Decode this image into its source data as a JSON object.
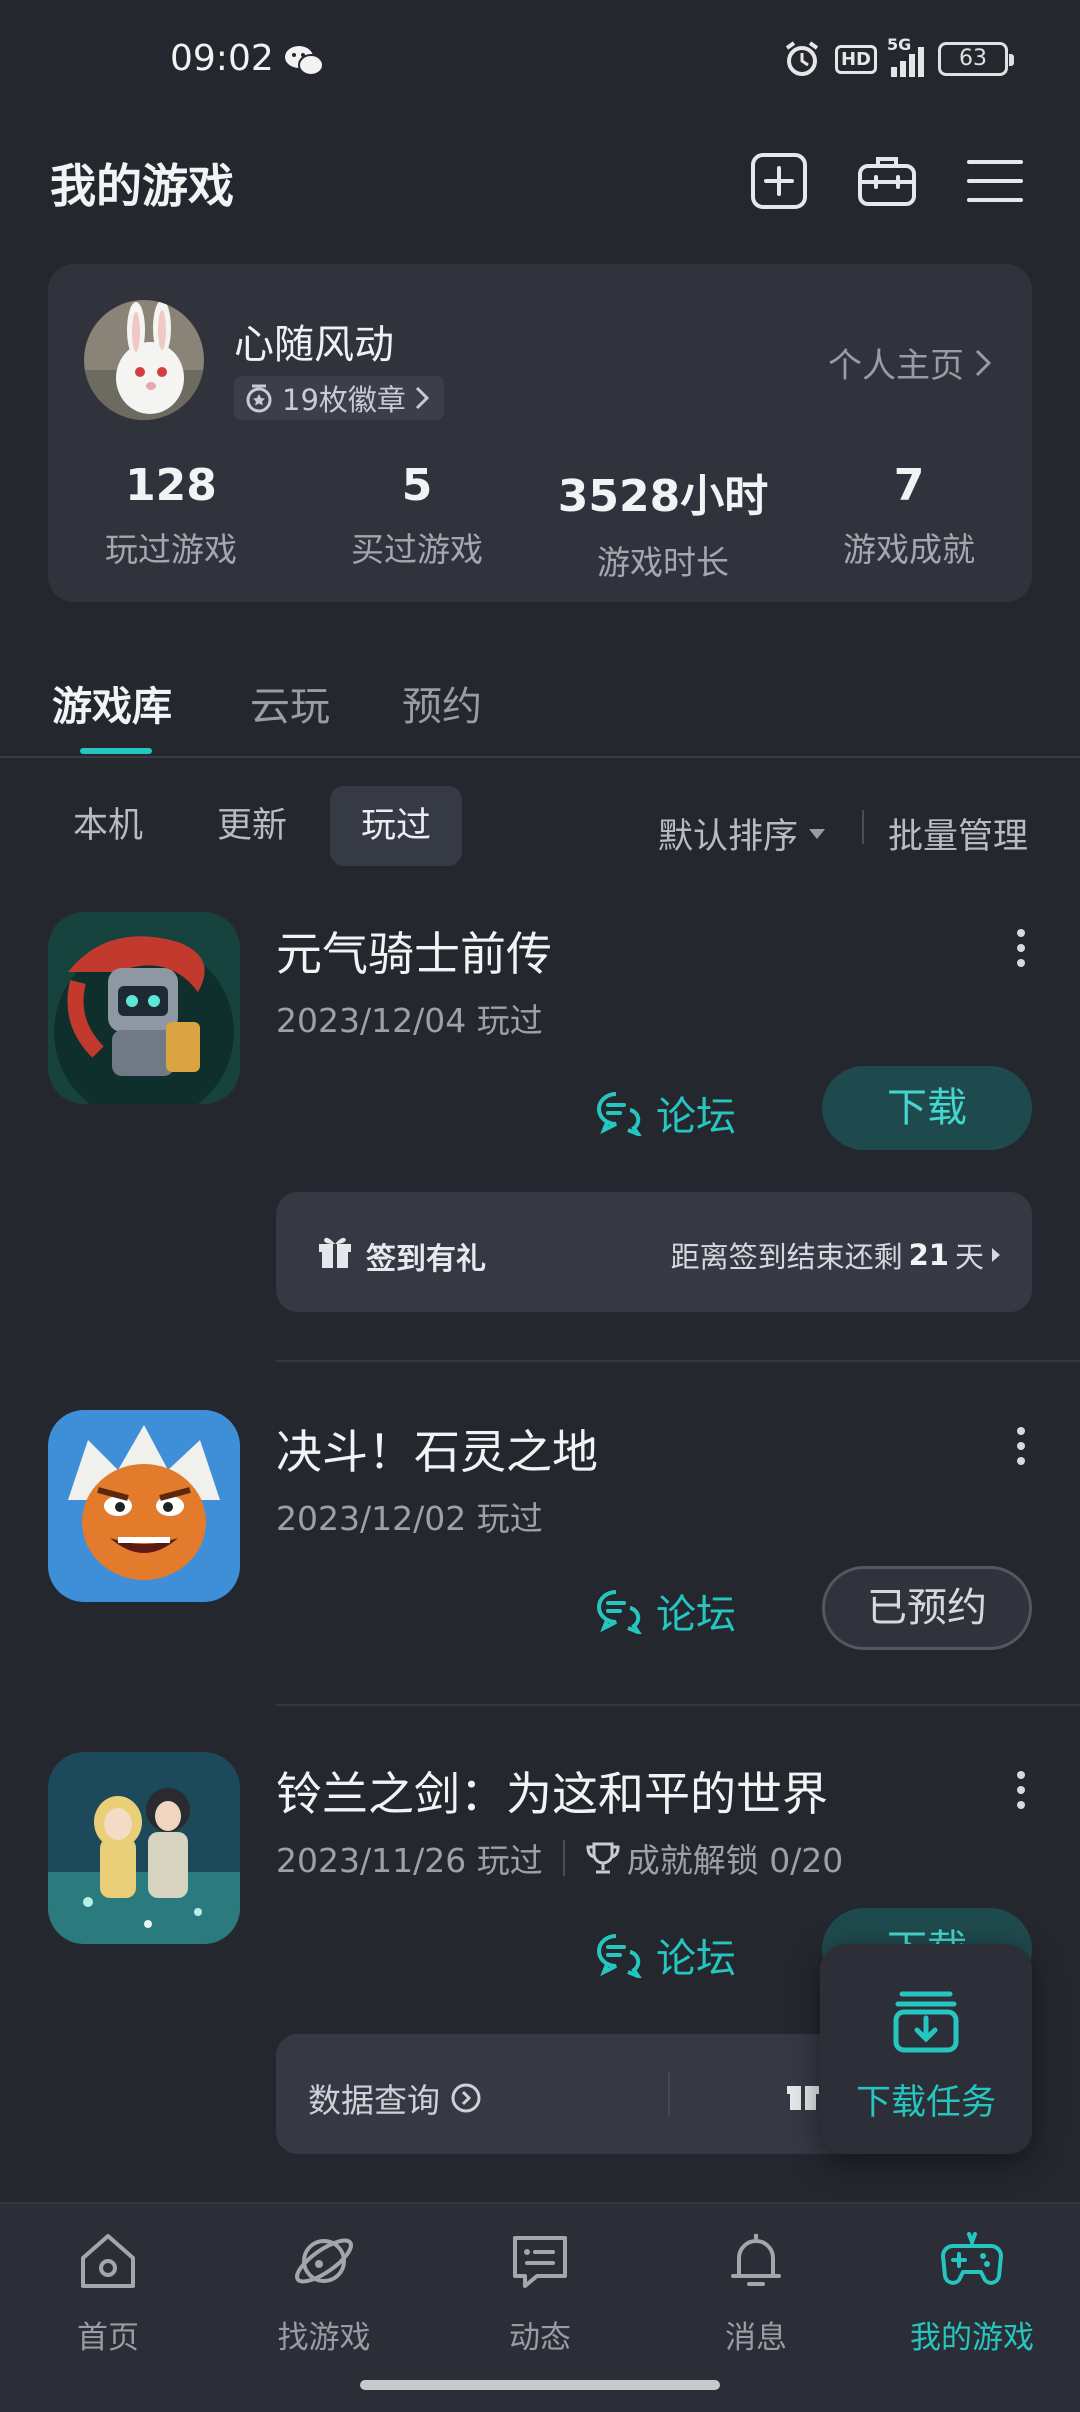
{
  "status_bar": {
    "time": "09:02",
    "network": "5G",
    "hd": "HD",
    "battery": "63"
  },
  "header": {
    "title": "我的游戏"
  },
  "profile": {
    "username": "心随风动",
    "badges": "19枚徽章",
    "homepage_link": "个人主页",
    "stats": [
      {
        "value": "128",
        "label": "玩过游戏"
      },
      {
        "value": "5",
        "label": "买过游戏"
      },
      {
        "value": "3528小时",
        "label": "游戏时长"
      },
      {
        "value": "7",
        "label": "游戏成就"
      }
    ]
  },
  "tabs": [
    {
      "label": "游戏库",
      "active": true
    },
    {
      "label": "云玩",
      "active": false
    },
    {
      "label": "预约",
      "active": false
    }
  ],
  "filters": {
    "chips": [
      {
        "label": "本机",
        "active": false
      },
      {
        "label": "更新",
        "active": false
      },
      {
        "label": "玩过",
        "active": true
      }
    ],
    "sort_label": "默认排序",
    "batch_label": "批量管理"
  },
  "games": [
    {
      "name": "元气骑士前传",
      "date": "2023/12/04 玩过",
      "forum_label": "论坛",
      "action_label": "下载",
      "banner": {
        "left": "签到有礼",
        "right_prefix": "距离签到结束还剩",
        "right_value": "21",
        "right_suffix": "天"
      }
    },
    {
      "name": "决斗！石灵之地",
      "date": "2023/12/02 玩过",
      "forum_label": "论坛",
      "action_label": "已预约"
    },
    {
      "name": "铃兰之剑：为这和平的世界",
      "date": "2023/11/26 玩过",
      "achievement": "成就解锁 0/20",
      "forum_label": "论坛",
      "action_label": "下载",
      "banner": {
        "left": "数据查询"
      }
    }
  ],
  "float_download": {
    "label": "下载任务"
  },
  "bottom_nav": [
    {
      "label": "首页",
      "icon": "home-icon"
    },
    {
      "label": "找游戏",
      "icon": "planet-icon"
    },
    {
      "label": "动态",
      "icon": "chat-icon"
    },
    {
      "label": "消息",
      "icon": "bell-icon"
    },
    {
      "label": "我的游戏",
      "icon": "gamepad-icon",
      "active": true
    }
  ],
  "colors": {
    "accent": "#26c6c0",
    "background": "#25272f",
    "card": "#30333c"
  }
}
